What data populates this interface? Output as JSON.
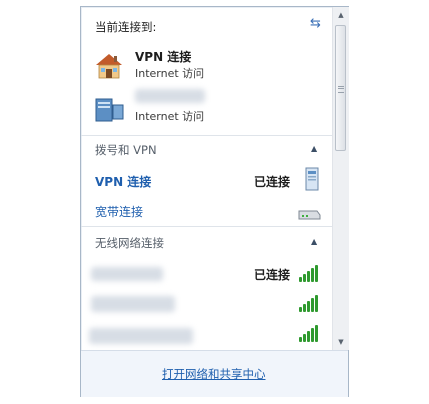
{
  "header": {
    "title": "当前连接到:",
    "refresh_icon": "refresh-icon"
  },
  "connections": [
    {
      "name": "VPN 连接",
      "subtitle": "Internet 访问",
      "icon": "home-network-icon"
    },
    {
      "name": "",
      "subtitle": "Internet 访问",
      "icon": "network-computer-icon"
    }
  ],
  "dialup_section": {
    "title": "拨号和 VPN",
    "items": [
      {
        "label": "VPN 连接",
        "status": "已连接",
        "icon": "vpn-computer-icon"
      },
      {
        "label": "宽带连接",
        "status": "",
        "icon": "modem-icon"
      }
    ]
  },
  "wireless_section": {
    "title": "无线网络连接",
    "items": [
      {
        "name": "",
        "status": "已连接",
        "signal": "full"
      },
      {
        "name": "",
        "status": "",
        "signal": "full"
      },
      {
        "name": "",
        "status": "",
        "signal": "full"
      }
    ]
  },
  "footer": {
    "link": "打开网络和共享中心"
  },
  "colors": {
    "link": "#1f5fae",
    "signal": "#2f9a2f",
    "border": "#a8b7c8"
  }
}
